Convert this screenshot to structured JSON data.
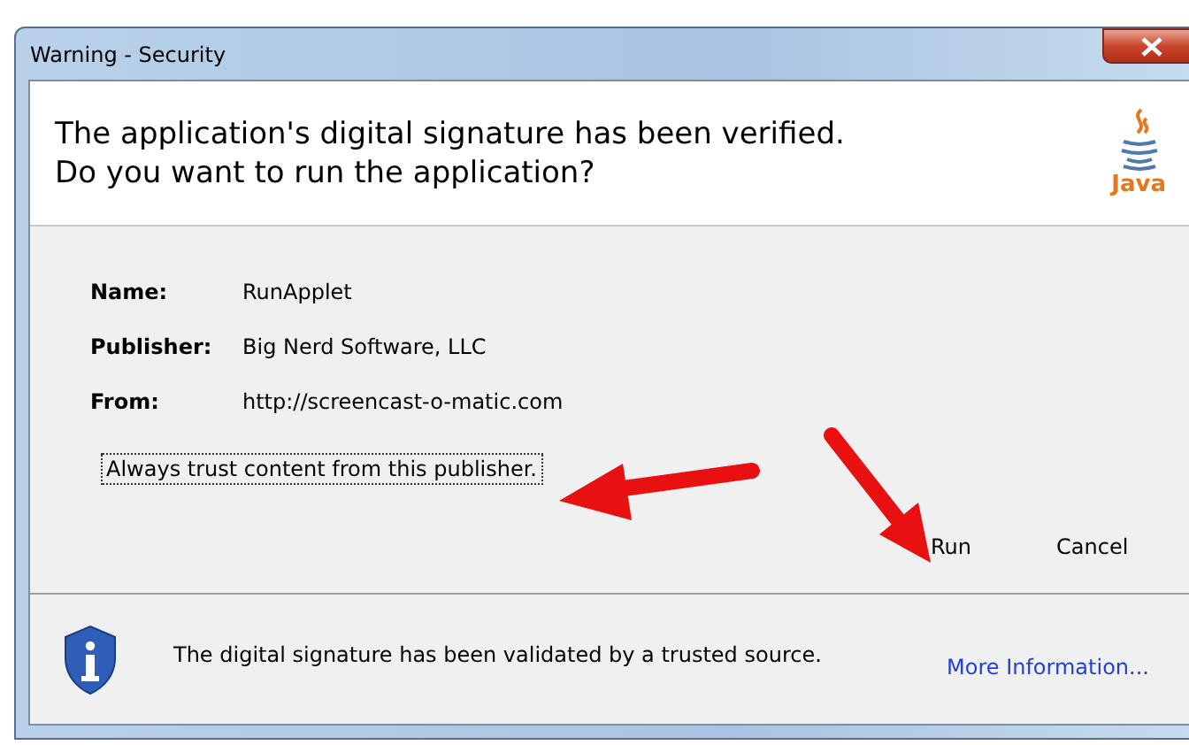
{
  "window": {
    "title": "Warning - Security"
  },
  "header": {
    "lines": [
      "The application's digital signature has been verified.",
      "Do you want to run the application?"
    ],
    "logo_text": "Java"
  },
  "details": [
    {
      "label": "Name:",
      "value": "RunApplet"
    },
    {
      "label": "Publisher:",
      "value": "Big Nerd Software, LLC"
    },
    {
      "label": "From:",
      "value": "http://screencast-o-matic.com"
    }
  ],
  "trust_option": {
    "label": "Always trust content from this publisher.",
    "focused": true
  },
  "buttons": [
    {
      "label": "Run"
    },
    {
      "label": "Cancel"
    }
  ],
  "footer": {
    "message": "The digital signature has been validated by a trusted source.",
    "link": "More Information..."
  }
}
